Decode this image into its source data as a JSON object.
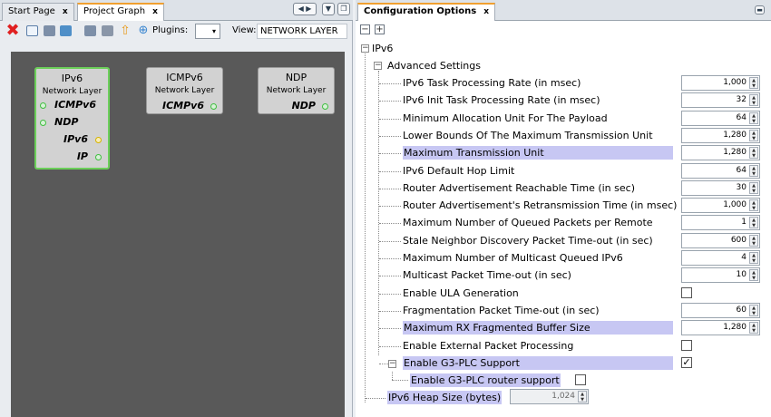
{
  "left": {
    "tabs": [
      {
        "label": "Start Page",
        "close": "x"
      },
      {
        "label": "Project Graph",
        "close": "x"
      }
    ],
    "toolbar": {
      "plugins_label": "Plugins:",
      "plugins_value": "",
      "view_label": "View:",
      "view_value": "NETWORK LAYER"
    },
    "nodes": [
      {
        "title": "IPv6",
        "subtitle": "Network Layer",
        "ports": [
          "ICMPv6",
          "NDP",
          "IPv6",
          "IP"
        ]
      },
      {
        "title": "ICMPv6",
        "subtitle": "Network Layer",
        "ports": [
          "ICMPv6"
        ]
      },
      {
        "title": "NDP",
        "subtitle": "Network Layer",
        "ports": [
          "NDP"
        ]
      }
    ]
  },
  "right": {
    "tab": {
      "label": "Configuration Options",
      "close": "x"
    },
    "root": "IPv6",
    "group": "Advanced Settings",
    "rows": [
      {
        "label": "IPv6 Task Processing Rate (in msec)",
        "value": "1,000"
      },
      {
        "label": "IPv6 Init Task Processing Rate (in msec)",
        "value": "32"
      },
      {
        "label": "Minimum Allocation Unit For The Payload",
        "value": "64"
      },
      {
        "label": "Lower Bounds Of The Maximum Transmission Unit",
        "value": "1,280"
      },
      {
        "label": "Maximum Transmission Unit",
        "value": "1,280"
      },
      {
        "label": "IPv6 Default Hop Limit",
        "value": "64"
      },
      {
        "label": "Router Advertisement Reachable Time (in sec)",
        "value": "30"
      },
      {
        "label": "Router Advertisement's Retransmission Time (in msec)",
        "value": "1,000"
      },
      {
        "label": "Maximum Number of Queued Packets per Remote",
        "value": "1"
      },
      {
        "label": "Stale Neighbor Discovery Packet Time-out (in sec)",
        "value": "600"
      },
      {
        "label": "Maximum Number of Multicast Queued IPv6",
        "value": "4"
      },
      {
        "label": "Multicast Packet Time-out (in sec)",
        "value": "10"
      },
      {
        "label": "Enable ULA Generation",
        "checked": false
      },
      {
        "label": "Fragmentation Packet Time-out (in sec)",
        "value": "60"
      },
      {
        "label": "Maximum RX Fragmented Buffer Size",
        "value": "1,280"
      },
      {
        "label": "Enable External Packet Processing",
        "checked": false
      },
      {
        "label": "Enable G3-PLC Support",
        "checked": true
      }
    ],
    "subrow": {
      "label": "Enable G3-PLC router support",
      "checked": false
    },
    "heap": {
      "label": "IPv6 Heap Size (bytes)",
      "value": "1,024"
    }
  }
}
